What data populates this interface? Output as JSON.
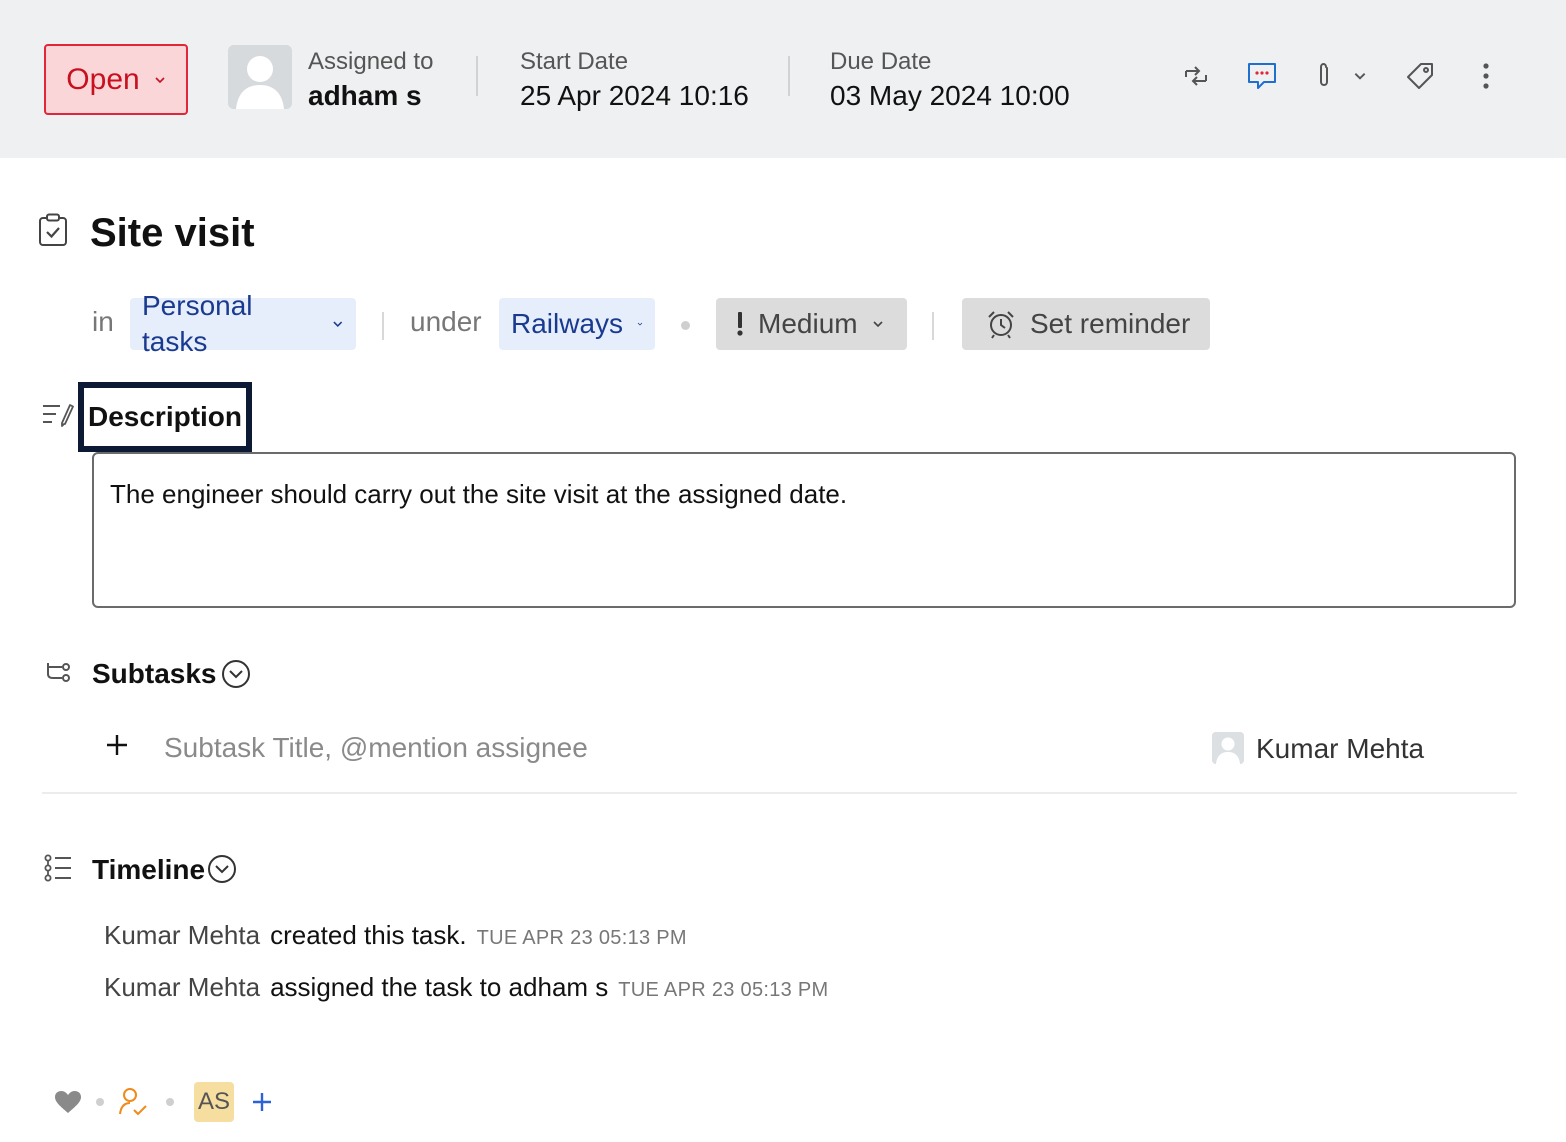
{
  "header": {
    "status": "Open",
    "assigned_label": "Assigned to",
    "assignee": "adham s",
    "start_label": "Start Date",
    "start_value": "25 Apr 2024 10:16",
    "due_label": "Due Date",
    "due_value": "03 May 2024 10:00",
    "tools": [
      "recurrence-icon",
      "comment-icon",
      "attachment-icon",
      "chevron-down-icon",
      "tag-icon",
      "more-vertical-icon"
    ]
  },
  "task": {
    "title": "Site visit",
    "in_label": "in",
    "tasklist": "Personal tasks",
    "under_label": "under",
    "project": "Railways",
    "priority": "Medium",
    "reminder": "Set reminder"
  },
  "description": {
    "label": "Description",
    "text": "The engineer should carry out the site visit at the assigned date."
  },
  "subtasks": {
    "title": "Subtasks",
    "placeholder": "Subtask Title, @mention assignee",
    "default_assignee": "Kumar Mehta"
  },
  "timeline": {
    "title": "Timeline",
    "entries": [
      {
        "actor": "Kumar Mehta",
        "action": "created this task.",
        "time": "TUE APR 23 05:13 PM"
      },
      {
        "actor": "Kumar Mehta",
        "action": "assigned the task to adham s",
        "time": "TUE APR 23 05:13 PM"
      }
    ]
  },
  "footer": {
    "follower_initials": "AS"
  },
  "colors": {
    "status_text": "#c8101f",
    "status_border": "#e0273a",
    "status_bg": "#fbd6d9",
    "chip_blue_bg": "#e6eefb",
    "chip_blue_text": "#1a3a8f",
    "comment_icon": "#1f6fd1",
    "follower_icon": "#f08a1c",
    "add_follower": "#2d62d6",
    "badge_bg": "#f5dea0"
  }
}
